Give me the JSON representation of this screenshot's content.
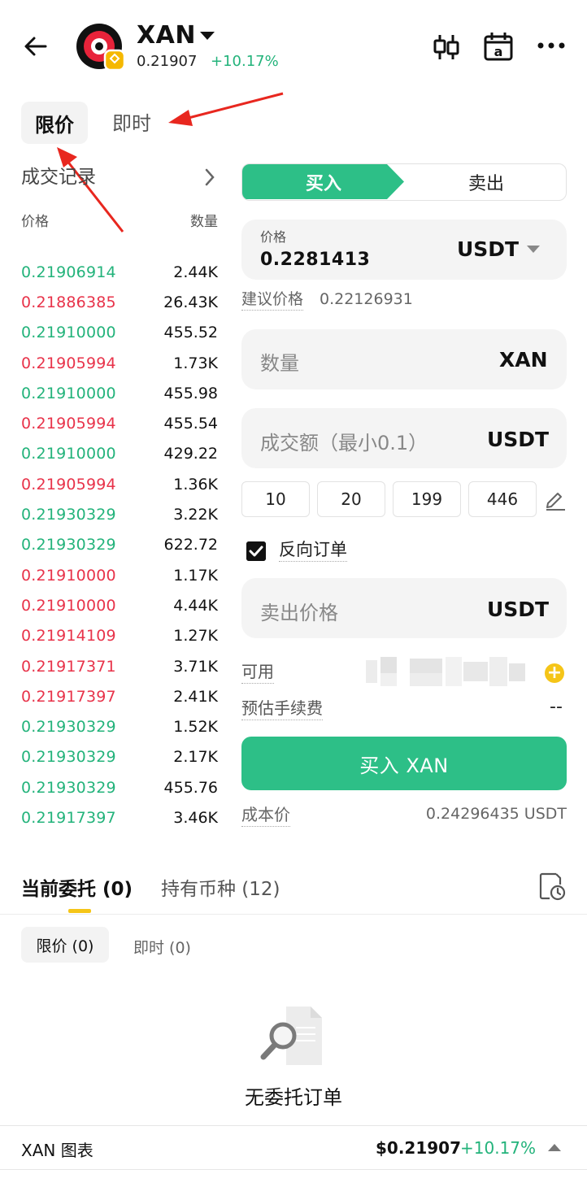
{
  "header": {
    "coin_name": "XAN",
    "price": "0.21907",
    "change": "+10.17%",
    "colors": {
      "up": "#23b37b",
      "down": "#e8334a",
      "accent": "#2dbf87",
      "highlight": "#f5c518"
    }
  },
  "order_type_tabs": {
    "limit": "限价",
    "instant": "即时"
  },
  "trade_history": {
    "title": "成交记录",
    "col_price": "价格",
    "col_qty": "数量",
    "rows": [
      {
        "price": "0.21906914",
        "qty": "2.44K",
        "side": "up"
      },
      {
        "price": "0.21886385",
        "qty": "26.43K",
        "side": "down"
      },
      {
        "price": "0.21910000",
        "qty": "455.52",
        "side": "up"
      },
      {
        "price": "0.21905994",
        "qty": "1.73K",
        "side": "down"
      },
      {
        "price": "0.21910000",
        "qty": "455.98",
        "side": "up"
      },
      {
        "price": "0.21905994",
        "qty": "455.54",
        "side": "down"
      },
      {
        "price": "0.21910000",
        "qty": "429.22",
        "side": "up"
      },
      {
        "price": "0.21905994",
        "qty": "1.36K",
        "side": "down"
      },
      {
        "price": "0.21930329",
        "qty": "3.22K",
        "side": "up"
      },
      {
        "price": "0.21930329",
        "qty": "622.72",
        "side": "up"
      },
      {
        "price": "0.21910000",
        "qty": "1.17K",
        "side": "down"
      },
      {
        "price": "0.21910000",
        "qty": "4.44K",
        "side": "down"
      },
      {
        "price": "0.21914109",
        "qty": "1.27K",
        "side": "down"
      },
      {
        "price": "0.21917371",
        "qty": "3.71K",
        "side": "down"
      },
      {
        "price": "0.21917397",
        "qty": "2.41K",
        "side": "down"
      },
      {
        "price": "0.21930329",
        "qty": "1.52K",
        "side": "up"
      },
      {
        "price": "0.21930329",
        "qty": "2.17K",
        "side": "up"
      },
      {
        "price": "0.21930329",
        "qty": "455.76",
        "side": "up"
      },
      {
        "price": "0.21917397",
        "qty": "3.46K",
        "side": "up"
      }
    ]
  },
  "trade_form": {
    "buy_label": "买入",
    "sell_label": "卖出",
    "price_label": "价格",
    "price_value": "0.2281413",
    "price_unit": "USDT",
    "suggest_label": "建议价格",
    "suggest_value": "0.22126931",
    "qty_placeholder": "数量",
    "qty_unit": "XAN",
    "amount_placeholder": "成交额（最小0.1）",
    "amount_unit": "USDT",
    "presets": [
      "10",
      "20",
      "199",
      "446"
    ],
    "reverse_order_label": "反向订单",
    "reverse_order_checked": true,
    "sell_price_placeholder": "卖出价格",
    "sell_price_unit": "USDT",
    "available_label": "可用",
    "fee_label": "预估手续费",
    "fee_value": "--",
    "submit_label": "买入 XAN",
    "cost_label": "成本价",
    "cost_value": "0.24296435 USDT"
  },
  "orders": {
    "tab_current": "当前委托 (0)",
    "tab_holdings": "持有币种 (12)",
    "sub_limit": "限价 (0)",
    "sub_instant": "即时 (0)",
    "empty_text": "无委托订单"
  },
  "footer": {
    "title": "XAN 图表",
    "price": "$0.21907",
    "change": "+10.17%"
  }
}
